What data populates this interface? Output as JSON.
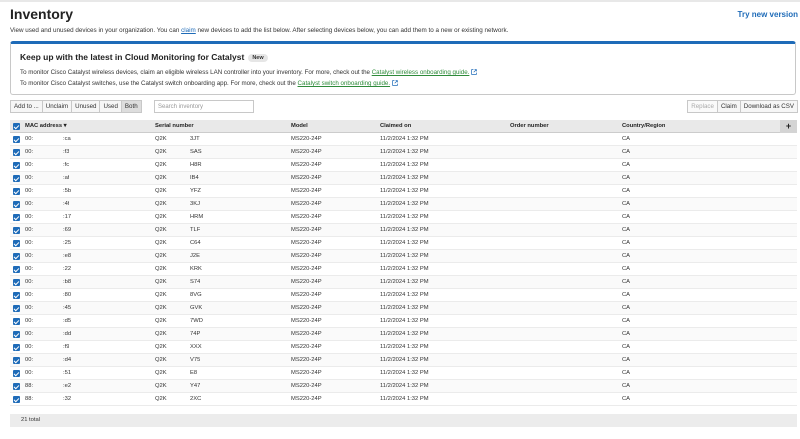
{
  "header": {
    "title": "Inventory",
    "try_new": "Try new version"
  },
  "intro": {
    "before": "View used and unused devices in your organization. You can ",
    "link": "claim",
    "after": " new devices to add the list below. After selecting devices below, you can add them to a new or existing network."
  },
  "banner": {
    "title": "Keep up with the latest in Cloud Monitoring for Catalyst",
    "badge": "New",
    "line1_text": "To monitor Cisco Catalyst wireless devices, claim an eligible wireless LAN controller into your inventory. For more, check out the ",
    "line1_link": "Catalyst wireless onboarding guide.",
    "line2_text": "To monitor Cisco Catalyst switches, use the Catalyst switch onboarding app. For more, check out the ",
    "line2_link": "Catalyst switch onboarding guide.",
    "accent_color": "#1e6bb8",
    "link_color": "#2e8b3a"
  },
  "toolbar": {
    "add_to": "Add to ...",
    "unclaim": "Unclaim",
    "unused": "Unused",
    "used": "Used",
    "both": "Both",
    "search_placeholder": "Search inventory",
    "replace": "Replace",
    "claim": "Claim",
    "download": "Download as CSV"
  },
  "table": {
    "columns": {
      "mac": "MAC address ▾",
      "serial": "Serial number",
      "model": "Model",
      "claimed": "Claimed on",
      "order": "Order number",
      "country": "Country/Region"
    },
    "rows": [
      {
        "mac_a": "00:",
        "mac_b": ":ca",
        "ser_a": "Q2K",
        "ser_b": "3JT",
        "model": "MS220-24P",
        "claimed": "11/2/2024 1:32 PM",
        "order": "",
        "country": "CA"
      },
      {
        "mac_a": "00:",
        "mac_b": ":f3",
        "ser_a": "Q2K",
        "ser_b": "SAS",
        "model": "MS220-24P",
        "claimed": "11/2/2024 1:32 PM",
        "order": "",
        "country": "CA"
      },
      {
        "mac_a": "00:",
        "mac_b": ":fc",
        "ser_a": "Q2K",
        "ser_b": "H8R",
        "model": "MS220-24P",
        "claimed": "11/2/2024 1:32 PM",
        "order": "",
        "country": "CA"
      },
      {
        "mac_a": "00:",
        "mac_b": ":af",
        "ser_a": "Q2K",
        "ser_b": "IB4",
        "model": "MS220-24P",
        "claimed": "11/2/2024 1:32 PM",
        "order": "",
        "country": "CA"
      },
      {
        "mac_a": "00:",
        "mac_b": ":5b",
        "ser_a": "Q2K",
        "ser_b": "YFZ",
        "model": "MS220-24P",
        "claimed": "11/2/2024 1:32 PM",
        "order": "",
        "country": "CA"
      },
      {
        "mac_a": "00:",
        "mac_b": ":4f",
        "ser_a": "Q2K",
        "ser_b": "3KJ",
        "model": "MS220-24P",
        "claimed": "11/2/2024 1:32 PM",
        "order": "",
        "country": "CA"
      },
      {
        "mac_a": "00:",
        "mac_b": ":17",
        "ser_a": "Q2K",
        "ser_b": "HRM",
        "model": "MS220-24P",
        "claimed": "11/2/2024 1:32 PM",
        "order": "",
        "country": "CA"
      },
      {
        "mac_a": "00:",
        "mac_b": ":69",
        "ser_a": "Q2K",
        "ser_b": "TLF",
        "model": "MS220-24P",
        "claimed": "11/2/2024 1:32 PM",
        "order": "",
        "country": "CA"
      },
      {
        "mac_a": "00:",
        "mac_b": ":25",
        "ser_a": "Q2K",
        "ser_b": "C64",
        "model": "MS220-24P",
        "claimed": "11/2/2024 1:32 PM",
        "order": "",
        "country": "CA"
      },
      {
        "mac_a": "00:",
        "mac_b": ":e8",
        "ser_a": "Q2K",
        "ser_b": "J2E",
        "model": "MS220-24P",
        "claimed": "11/2/2024 1:32 PM",
        "order": "",
        "country": "CA"
      },
      {
        "mac_a": "00:",
        "mac_b": ":22",
        "ser_a": "Q2K",
        "ser_b": "KRK",
        "model": "MS220-24P",
        "claimed": "11/2/2024 1:32 PM",
        "order": "",
        "country": "CA"
      },
      {
        "mac_a": "00:",
        "mac_b": ":b8",
        "ser_a": "Q2K",
        "ser_b": "S74",
        "model": "MS220-24P",
        "claimed": "11/2/2024 1:32 PM",
        "order": "",
        "country": "CA"
      },
      {
        "mac_a": "00:",
        "mac_b": ":80",
        "ser_a": "Q2K",
        "ser_b": "8VG",
        "model": "MS220-24P",
        "claimed": "11/2/2024 1:32 PM",
        "order": "",
        "country": "CA"
      },
      {
        "mac_a": "00:",
        "mac_b": ":45",
        "ser_a": "Q2K",
        "ser_b": "GVK",
        "model": "MS220-24P",
        "claimed": "11/2/2024 1:32 PM",
        "order": "",
        "country": "CA"
      },
      {
        "mac_a": "00:",
        "mac_b": ":d5",
        "ser_a": "Q2K",
        "ser_b": "7WD",
        "model": "MS220-24P",
        "claimed": "11/2/2024 1:32 PM",
        "order": "",
        "country": "CA"
      },
      {
        "mac_a": "00:",
        "mac_b": ":dd",
        "ser_a": "Q2K",
        "ser_b": "74P",
        "model": "MS220-24P",
        "claimed": "11/2/2024 1:32 PM",
        "order": "",
        "country": "CA"
      },
      {
        "mac_a": "00:",
        "mac_b": ":f9",
        "ser_a": "Q2K",
        "ser_b": "XXX",
        "model": "MS220-24P",
        "claimed": "11/2/2024 1:32 PM",
        "order": "",
        "country": "CA"
      },
      {
        "mac_a": "00:",
        "mac_b": ":d4",
        "ser_a": "Q2K",
        "ser_b": "V75",
        "model": "MS220-24P",
        "claimed": "11/2/2024 1:32 PM",
        "order": "",
        "country": "CA"
      },
      {
        "mac_a": "00:",
        "mac_b": ":51",
        "ser_a": "Q2K",
        "ser_b": "E8",
        "model": "MS220-24P",
        "claimed": "11/2/2024 1:32 PM",
        "order": "",
        "country": "CA"
      },
      {
        "mac_a": "88:",
        "mac_b": ":e2",
        "ser_a": "Q2K",
        "ser_b": "Y47",
        "model": "MS220-24P",
        "claimed": "11/2/2024 1:32 PM",
        "order": "",
        "country": "CA"
      },
      {
        "mac_a": "88:",
        "mac_b": ":32",
        "ser_a": "Q2K",
        "ser_b": "2XC",
        "model": "MS220-24P",
        "claimed": "11/2/2024 1:32 PM",
        "order": "",
        "country": "CA"
      }
    ],
    "footer": "21 total"
  }
}
